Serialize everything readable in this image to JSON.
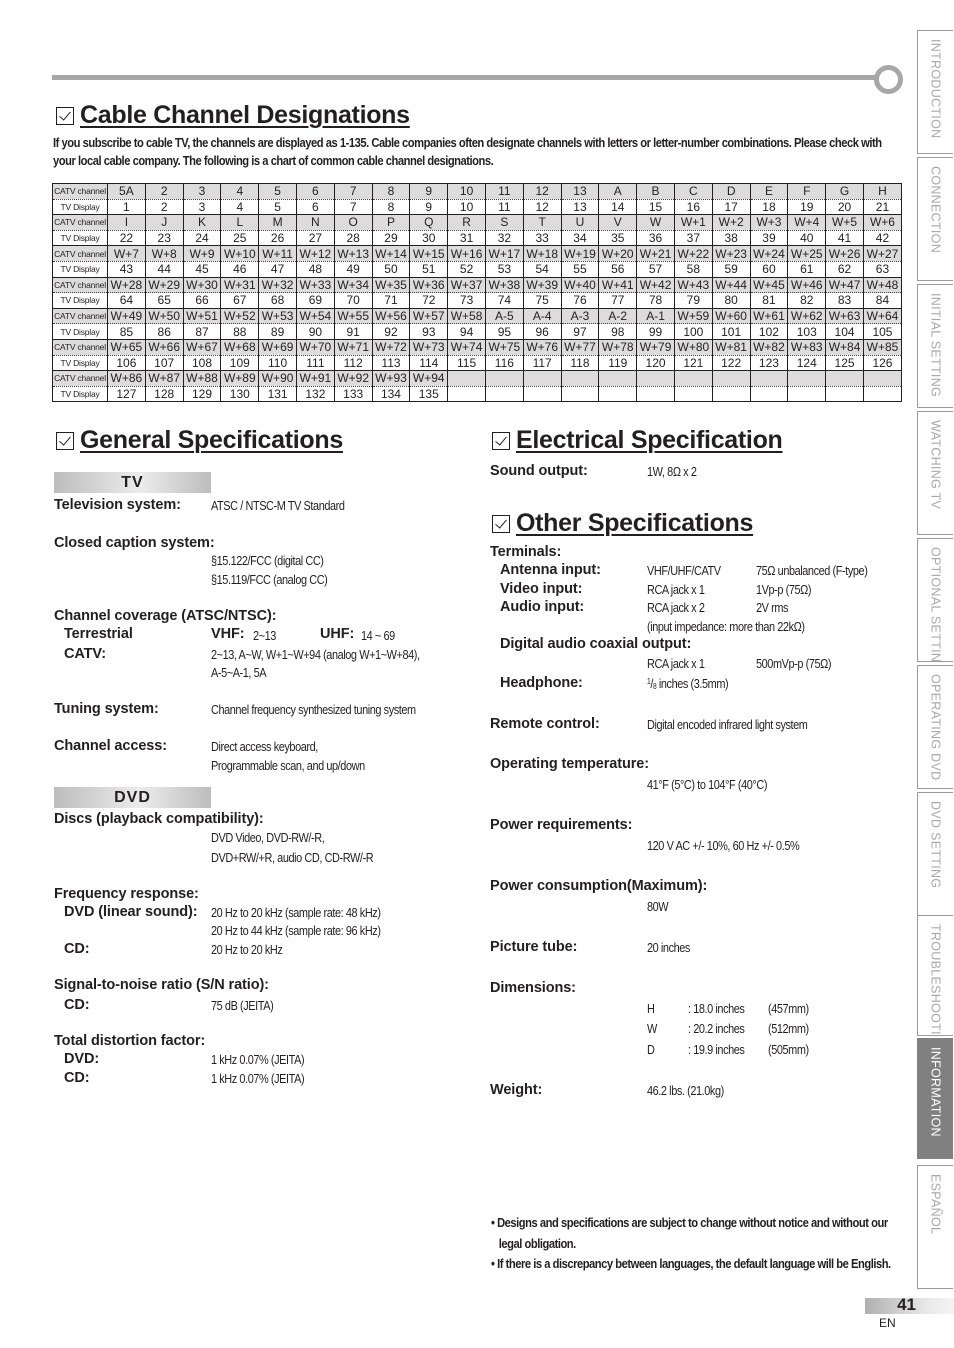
{
  "side_tabs": [
    {
      "label": "INTRODUCTION",
      "active": false
    },
    {
      "label": "CONNECTION",
      "active": false
    },
    {
      "label": "INITIAL  SETTING",
      "active": false
    },
    {
      "label": "WATCHING  TV",
      "active": false
    },
    {
      "label": "OPTIONAL  SETTING",
      "active": false
    },
    {
      "label": "OPERATING  DVD",
      "active": false
    },
    {
      "label": "DVD  SETTING",
      "active": false
    },
    {
      "label": "TROUBLESHOOTING",
      "active": false
    },
    {
      "label": "INFORMATION",
      "active": true
    },
    {
      "label": "ESPAÑOL",
      "active": false
    }
  ],
  "cable": {
    "title": "Cable Channel Designations",
    "intro": "If you subscribe to cable TV, the channels are displayed as 1-135. Cable companies often designate channels with letters or letter-number combinations. Please check with your local cable company. The following is a chart of common cable channel designations.",
    "row_labels": {
      "catv": "CATV channel",
      "display": "TV Display"
    },
    "rows": [
      {
        "catv": [
          "5A",
          "2",
          "3",
          "4",
          "5",
          "6",
          "7",
          "8",
          "9",
          "10",
          "11",
          "12",
          "13",
          "A",
          "B",
          "C",
          "D",
          "E",
          "F",
          "G",
          "H"
        ],
        "display": [
          "1",
          "2",
          "3",
          "4",
          "5",
          "6",
          "7",
          "8",
          "9",
          "10",
          "11",
          "12",
          "13",
          "14",
          "15",
          "16",
          "17",
          "18",
          "19",
          "20",
          "21"
        ]
      },
      {
        "catv": [
          "I",
          "J",
          "K",
          "L",
          "M",
          "N",
          "O",
          "P",
          "Q",
          "R",
          "S",
          "T",
          "U",
          "V",
          "W",
          "W+1",
          "W+2",
          "W+3",
          "W+4",
          "W+5",
          "W+6"
        ],
        "display": [
          "22",
          "23",
          "24",
          "25",
          "26",
          "27",
          "28",
          "29",
          "30",
          "31",
          "32",
          "33",
          "34",
          "35",
          "36",
          "37",
          "38",
          "39",
          "40",
          "41",
          "42"
        ]
      },
      {
        "catv": [
          "W+7",
          "W+8",
          "W+9",
          "W+10",
          "W+11",
          "W+12",
          "W+13",
          "W+14",
          "W+15",
          "W+16",
          "W+17",
          "W+18",
          "W+19",
          "W+20",
          "W+21",
          "W+22",
          "W+23",
          "W+24",
          "W+25",
          "W+26",
          "W+27"
        ],
        "display": [
          "43",
          "44",
          "45",
          "46",
          "47",
          "48",
          "49",
          "50",
          "51",
          "52",
          "53",
          "54",
          "55",
          "56",
          "57",
          "58",
          "59",
          "60",
          "61",
          "62",
          "63"
        ]
      },
      {
        "catv": [
          "W+28",
          "W+29",
          "W+30",
          "W+31",
          "W+32",
          "W+33",
          "W+34",
          "W+35",
          "W+36",
          "W+37",
          "W+38",
          "W+39",
          "W+40",
          "W+41",
          "W+42",
          "W+43",
          "W+44",
          "W+45",
          "W+46",
          "W+47",
          "W+48"
        ],
        "display": [
          "64",
          "65",
          "66",
          "67",
          "68",
          "69",
          "70",
          "71",
          "72",
          "73",
          "74",
          "75",
          "76",
          "77",
          "78",
          "79",
          "80",
          "81",
          "82",
          "83",
          "84"
        ]
      },
      {
        "catv": [
          "W+49",
          "W+50",
          "W+51",
          "W+52",
          "W+53",
          "W+54",
          "W+55",
          "W+56",
          "W+57",
          "W+58",
          "A-5",
          "A-4",
          "A-3",
          "A-2",
          "A-1",
          "W+59",
          "W+60",
          "W+61",
          "W+62",
          "W+63",
          "W+64"
        ],
        "display": [
          "85",
          "86",
          "87",
          "88",
          "89",
          "90",
          "91",
          "92",
          "93",
          "94",
          "95",
          "96",
          "97",
          "98",
          "99",
          "100",
          "101",
          "102",
          "103",
          "104",
          "105"
        ]
      },
      {
        "catv": [
          "W+65",
          "W+66",
          "W+67",
          "W+68",
          "W+69",
          "W+70",
          "W+71",
          "W+72",
          "W+73",
          "W+74",
          "W+75",
          "W+76",
          "W+77",
          "W+78",
          "W+79",
          "W+80",
          "W+81",
          "W+82",
          "W+83",
          "W+84",
          "W+85"
        ],
        "display": [
          "106",
          "107",
          "108",
          "109",
          "110",
          "111",
          "112",
          "113",
          "114",
          "115",
          "116",
          "117",
          "118",
          "119",
          "120",
          "121",
          "122",
          "123",
          "124",
          "125",
          "126"
        ]
      },
      {
        "catv": [
          "W+86",
          "W+87",
          "W+88",
          "W+89",
          "W+90",
          "W+91",
          "W+92",
          "W+93",
          "W+94",
          "",
          "",
          "",
          "",
          "",
          "",
          "",
          "",
          "",
          "",
          "",
          ""
        ],
        "display": [
          "127",
          "128",
          "129",
          "130",
          "131",
          "132",
          "133",
          "134",
          "135",
          "",
          "",
          "",
          "",
          "",
          "",
          "",
          "",
          "",
          "",
          "",
          ""
        ]
      }
    ]
  },
  "general": {
    "title": "General Specifications",
    "tv_band": "TV",
    "television_system": {
      "label": "Television system:",
      "value": "ATSC / NTSC-M TV Standard"
    },
    "closed_caption": {
      "label": "Closed caption system:",
      "values": [
        "§15.122/FCC (digital CC)",
        "§15.119/FCC (analog CC)"
      ]
    },
    "channel_coverage": {
      "label": "Channel coverage (ATSC/NTSC):",
      "terrestrial_label": "Terrestrial",
      "vhf_label": "VHF:",
      "vhf_value": "2~13",
      "uhf_label": "UHF:",
      "uhf_value": "14 ~ 69",
      "catv_label": "CATV:",
      "catv_values": [
        "2~13, A~W, W+1~W+94 (analog W+1~W+84),",
        "A-5~A-1, 5A"
      ]
    },
    "tuning": {
      "label": "Tuning system:",
      "value": "Channel frequency synthesized tuning system"
    },
    "channel_access": {
      "label": "Channel access:",
      "values": [
        "Direct access keyboard,",
        "Programmable scan, and up/down"
      ]
    },
    "dvd_band": "DVD",
    "discs": {
      "label": "Discs (playback compatibility):",
      "values": [
        "DVD Video, DVD-RW/-R,",
        "DVD+RW/+R, audio CD, CD-RW/-R"
      ]
    },
    "frequency": {
      "label": "Frequency response:",
      "dvd_label": "DVD (linear sound):",
      "dvd_values": [
        "20 Hz to 20 kHz (sample rate: 48 kHz)",
        "20 Hz to 44 kHz (sample rate: 96 kHz)"
      ],
      "cd_label": "CD:",
      "cd_value": "20 Hz to 20 kHz"
    },
    "snr": {
      "label": "Signal-to-noise ratio (S/N ratio):",
      "cd_label": "CD:",
      "cd_value": "75 dB (JEITA)"
    },
    "distortion": {
      "label": "Total distortion factor:",
      "dvd_label": "DVD:",
      "dvd_value": "1 kHz  0.07% (JEITA)",
      "cd_label": "CD:",
      "cd_value": "1 kHz  0.07% (JEITA)"
    }
  },
  "electrical": {
    "title": "Electrical Specification",
    "sound_output": {
      "label": "Sound output:",
      "value": "1W, 8Ω x 2"
    }
  },
  "other": {
    "title": "Other Specifications",
    "terminals_label": "Terminals:",
    "antenna": {
      "label": "Antenna input:",
      "v1": "VHF/UHF/CATV",
      "v2": "75Ω unbalanced (F-type)"
    },
    "video": {
      "label": "Video input:",
      "v1": "RCA jack x 1",
      "v2": "1Vp-p (75Ω)"
    },
    "audio": {
      "label": "Audio input:",
      "v1": "RCA jack x 2",
      "v2": "2V rms",
      "v3": "(input impedance: more than 22kΩ)"
    },
    "digital_audio": {
      "label": "Digital audio coaxial output:",
      "v1": "RCA jack x 1",
      "v2": "500mVp-p (75Ω)"
    },
    "headphone": {
      "label": "Headphone:",
      "frac_num": "1",
      "frac_den": "8",
      "value": " inches (3.5mm)"
    },
    "remote": {
      "label": "Remote control:",
      "value": "Digital encoded infrared light system"
    },
    "operating_temp": {
      "label": "Operating temperature:",
      "value": "41°F (5°C) to 104°F (40°C)"
    },
    "power_req": {
      "label": "Power requirements:",
      "value": "120 V AC +/- 10%, 60 Hz +/- 0.5%"
    },
    "power_cons": {
      "label": "Power consumption(Maximum):",
      "value": "80W"
    },
    "picture_tube": {
      "label": "Picture tube:",
      "value": "20 inches"
    },
    "dimensions": {
      "label": "Dimensions:",
      "rows": [
        {
          "axis": "H",
          "inches": ": 18.0 inches",
          "mm": "(457mm)"
        },
        {
          "axis": "W",
          "inches": ": 20.2 inches",
          "mm": "(512mm)"
        },
        {
          "axis": "D",
          "inches": ": 19.9 inches",
          "mm": "(505mm)"
        }
      ]
    },
    "weight": {
      "label": "Weight:",
      "value": "46.2 lbs. (21.0kg)"
    }
  },
  "notes": [
    "• Designs and specifications are subject to change without notice and without our legal obligation.",
    "• If there is a discrepancy between languages, the default language will be English."
  ],
  "footer": {
    "page_number": "41",
    "language": "EN"
  }
}
